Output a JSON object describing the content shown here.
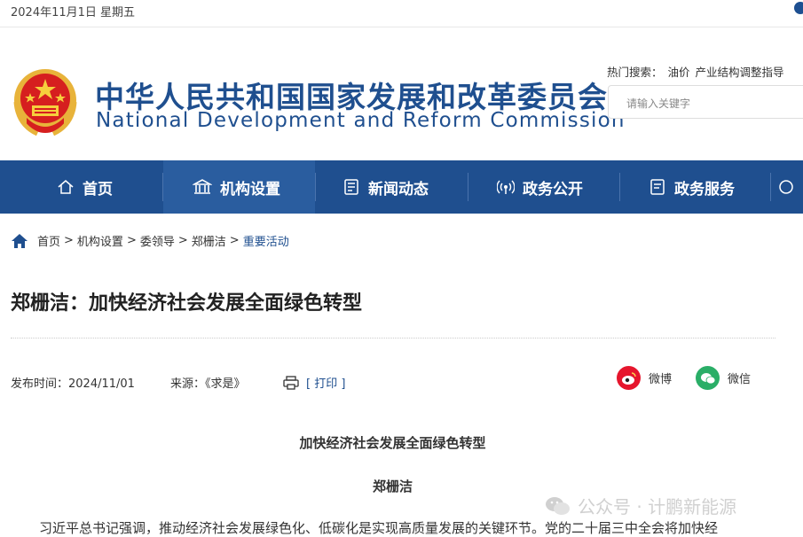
{
  "topbar": {
    "date": "2024年11月1日 星期五"
  },
  "header": {
    "title_cn": "中华人民共和国国家发展和改革委员会",
    "title_en": "National Development and Reform Commission",
    "hot_label": "热门搜索：",
    "hot_terms": [
      "油价",
      "产业结构调整指导"
    ],
    "search_placeholder": "请输入关键字"
  },
  "nav": {
    "items": [
      {
        "label": "首页",
        "icon": "home-icon"
      },
      {
        "label": "机构设置",
        "icon": "institution-icon"
      },
      {
        "label": "新闻动态",
        "icon": "news-icon"
      },
      {
        "label": "政务公开",
        "icon": "broadcast-icon"
      },
      {
        "label": "政务服务",
        "icon": "document-icon"
      }
    ]
  },
  "breadcrumb": {
    "items": [
      "首页",
      "机构设置",
      "委领导",
      "郑栅洁"
    ],
    "current": "重要活动",
    "separator": ">"
  },
  "article": {
    "title": "郑栅洁：加快经济社会发展全面绿色转型",
    "publish_label": "发布时间：2024/11/01",
    "source_label": "来源：《求是》",
    "print_label": "[ 打印 ]",
    "share_weibo": "微博",
    "share_wechat": "微信",
    "sub_title": "加快经济社会发展全面绿色转型",
    "author": "郑栅洁",
    "first_line": "习近平总书记强调，推动经济社会发展绿色化、低碳化是实现高质量发展的关键环节。党的二十届三中全会将加快经"
  },
  "watermark": {
    "text": "公众号 · 计鹏新能源"
  },
  "colors": {
    "brand": "#1f4f8f",
    "weibo": "#e6162d",
    "wechat": "#2aae67"
  }
}
